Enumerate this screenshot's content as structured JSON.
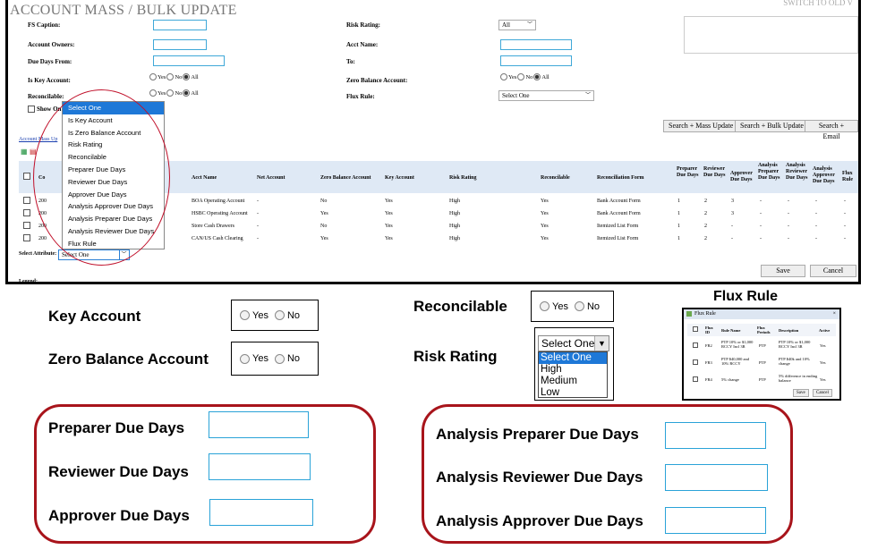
{
  "screen": {
    "title": "ACCOUNT MASS / BULK UPDATE",
    "switch_link": "SWITCH TO OLD V",
    "filters": {
      "fs_caption": "FS Caption:",
      "account_owners": "Account Owners:",
      "due_days_from": "Due Days From:",
      "is_key_account": "Is Key Account:",
      "reconcilable": "Reconcilable:",
      "risk_rating": "Risk Rating:",
      "risk_rating_value": "All",
      "acct_name": "Acct Name:",
      "to": "To:",
      "zero_balance_account": "Zero Balance Account:",
      "flux_rule": "Flux Rule:",
      "flux_rule_value": "Select One",
      "yes": "Yes",
      "no": "No",
      "all": "All",
      "show_only": "Show On"
    },
    "account_mass_link": "Account Mass Up",
    "buttons": {
      "mass_update": "Search + Mass Update",
      "bulk_update": "Search + Bulk Update",
      "email": "Search + Email",
      "save": "Save",
      "cancel": "Cancel"
    },
    "table": {
      "headers": {
        "co": "Co",
        "acct_name": "Acct Name",
        "net_account": "Net Account",
        "zero_balance": "Zero Balance Account",
        "key_account": "Key Account",
        "risk_rating": "Risk Rating",
        "reconcilable": "Reconcilable",
        "recon_form": "Reconciliation Form",
        "preparer_due": "Preparer Due Days",
        "reviewer_due": "Reviewer Due Days",
        "approver_due": "Approver Due Days",
        "an_preparer_due": "Analysis Preparer Due Days",
        "an_reviewer_due": "Analysis Reviewer Due Days",
        "an_approver_due": "Analysis Approver Due Days",
        "flux_rule": "Flux Rule"
      },
      "rows": [
        {
          "co": "200",
          "acct": "BOA Operating Account",
          "net": "-",
          "zero": "No",
          "key": "Yes",
          "risk": "High",
          "recon": "Yes",
          "form": "Bank Account Form",
          "prep": "1",
          "rev": "2",
          "appr": "3",
          "ap": "-",
          "ar": "-",
          "aa": "-",
          "flux": "-"
        },
        {
          "co": "200",
          "acct": "HSBC Operating Account",
          "net": "-",
          "zero": "Yes",
          "key": "Yes",
          "risk": "High",
          "recon": "Yes",
          "form": "Bank Account Form",
          "prep": "1",
          "rev": "2",
          "appr": "3",
          "ap": "-",
          "ar": "-",
          "aa": "-",
          "flux": "-"
        },
        {
          "co": "200",
          "acct": "Store Cash Drawers",
          "net": "-",
          "zero": "No",
          "key": "Yes",
          "risk": "High",
          "recon": "Yes",
          "form": "Itemized List Form",
          "prep": "1",
          "rev": "2",
          "appr": "-",
          "ap": "-",
          "ar": "-",
          "aa": "-",
          "flux": "-"
        },
        {
          "co": "200",
          "acct": "CAN/US Cash Clearing",
          "net": "-",
          "zero": "Yes",
          "key": "Yes",
          "risk": "High",
          "recon": "Yes",
          "form": "Itemized List Form",
          "prep": "1",
          "rev": "2",
          "appr": "-",
          "ap": "-",
          "ar": "-",
          "aa": "-",
          "flux": "-"
        }
      ]
    },
    "select_attribute_label": "Select Attribute:",
    "select_attribute_value": "Select One",
    "legend": "Legend:",
    "dropdown_items": [
      "Select One",
      "Is Key Account",
      "Is Zero Balance Account",
      "Risk Rating",
      "Reconcilable",
      "Preparer Due Days",
      "Reviewer Due Days",
      "Approver Due Days",
      "Analysis Approver Due Days",
      "Analysis Preparer Due Days",
      "Analysis Reviewer Due Days",
      "Flux Rule"
    ]
  },
  "panels": {
    "key_account": "Key Account",
    "zero_balance": "Zero Balance Account",
    "reconcilable": "Reconcilable",
    "risk_rating": "Risk Rating",
    "yes": "Yes",
    "no": "No",
    "risk_select": "Select One",
    "risk_options": [
      "Select One",
      "High",
      "Medium",
      "Low"
    ],
    "flux_rule_title": "Flux Rule",
    "flux_dialog": {
      "title": "Flux Rule",
      "headers": [
        "Flux ID",
        "Rule Name",
        "Flux Periods",
        "Description",
        "Active"
      ],
      "rows": [
        {
          "id": "FR2",
          "name": "PTP 10% or $1,000 RCCY Incl 3R",
          "period": "PTP",
          "desc": "PTP 10% or $1,000 RCCY Incl 3R",
          "active": "Yes"
        },
        {
          "id": "FR3",
          "name": "PTP $40,000 and 10% RCCY",
          "period": "PTP",
          "desc": "PTP $40k and 10% change",
          "active": "Yes"
        },
        {
          "id": "FR4",
          "name": "5% change",
          "period": "PTP",
          "desc": "5% difference in ending balance",
          "active": "Yes"
        }
      ],
      "save": "Save",
      "cancel": "Cancel"
    },
    "preparer_due": "Preparer Due Days",
    "reviewer_due": "Reviewer Due Days",
    "approver_due": "Approver Due Days",
    "an_preparer_due": "Analysis Preparer Due Days",
    "an_reviewer_due": "Analysis Reviewer Due Days",
    "an_approver_due": "Analysis Approver Due Days"
  }
}
